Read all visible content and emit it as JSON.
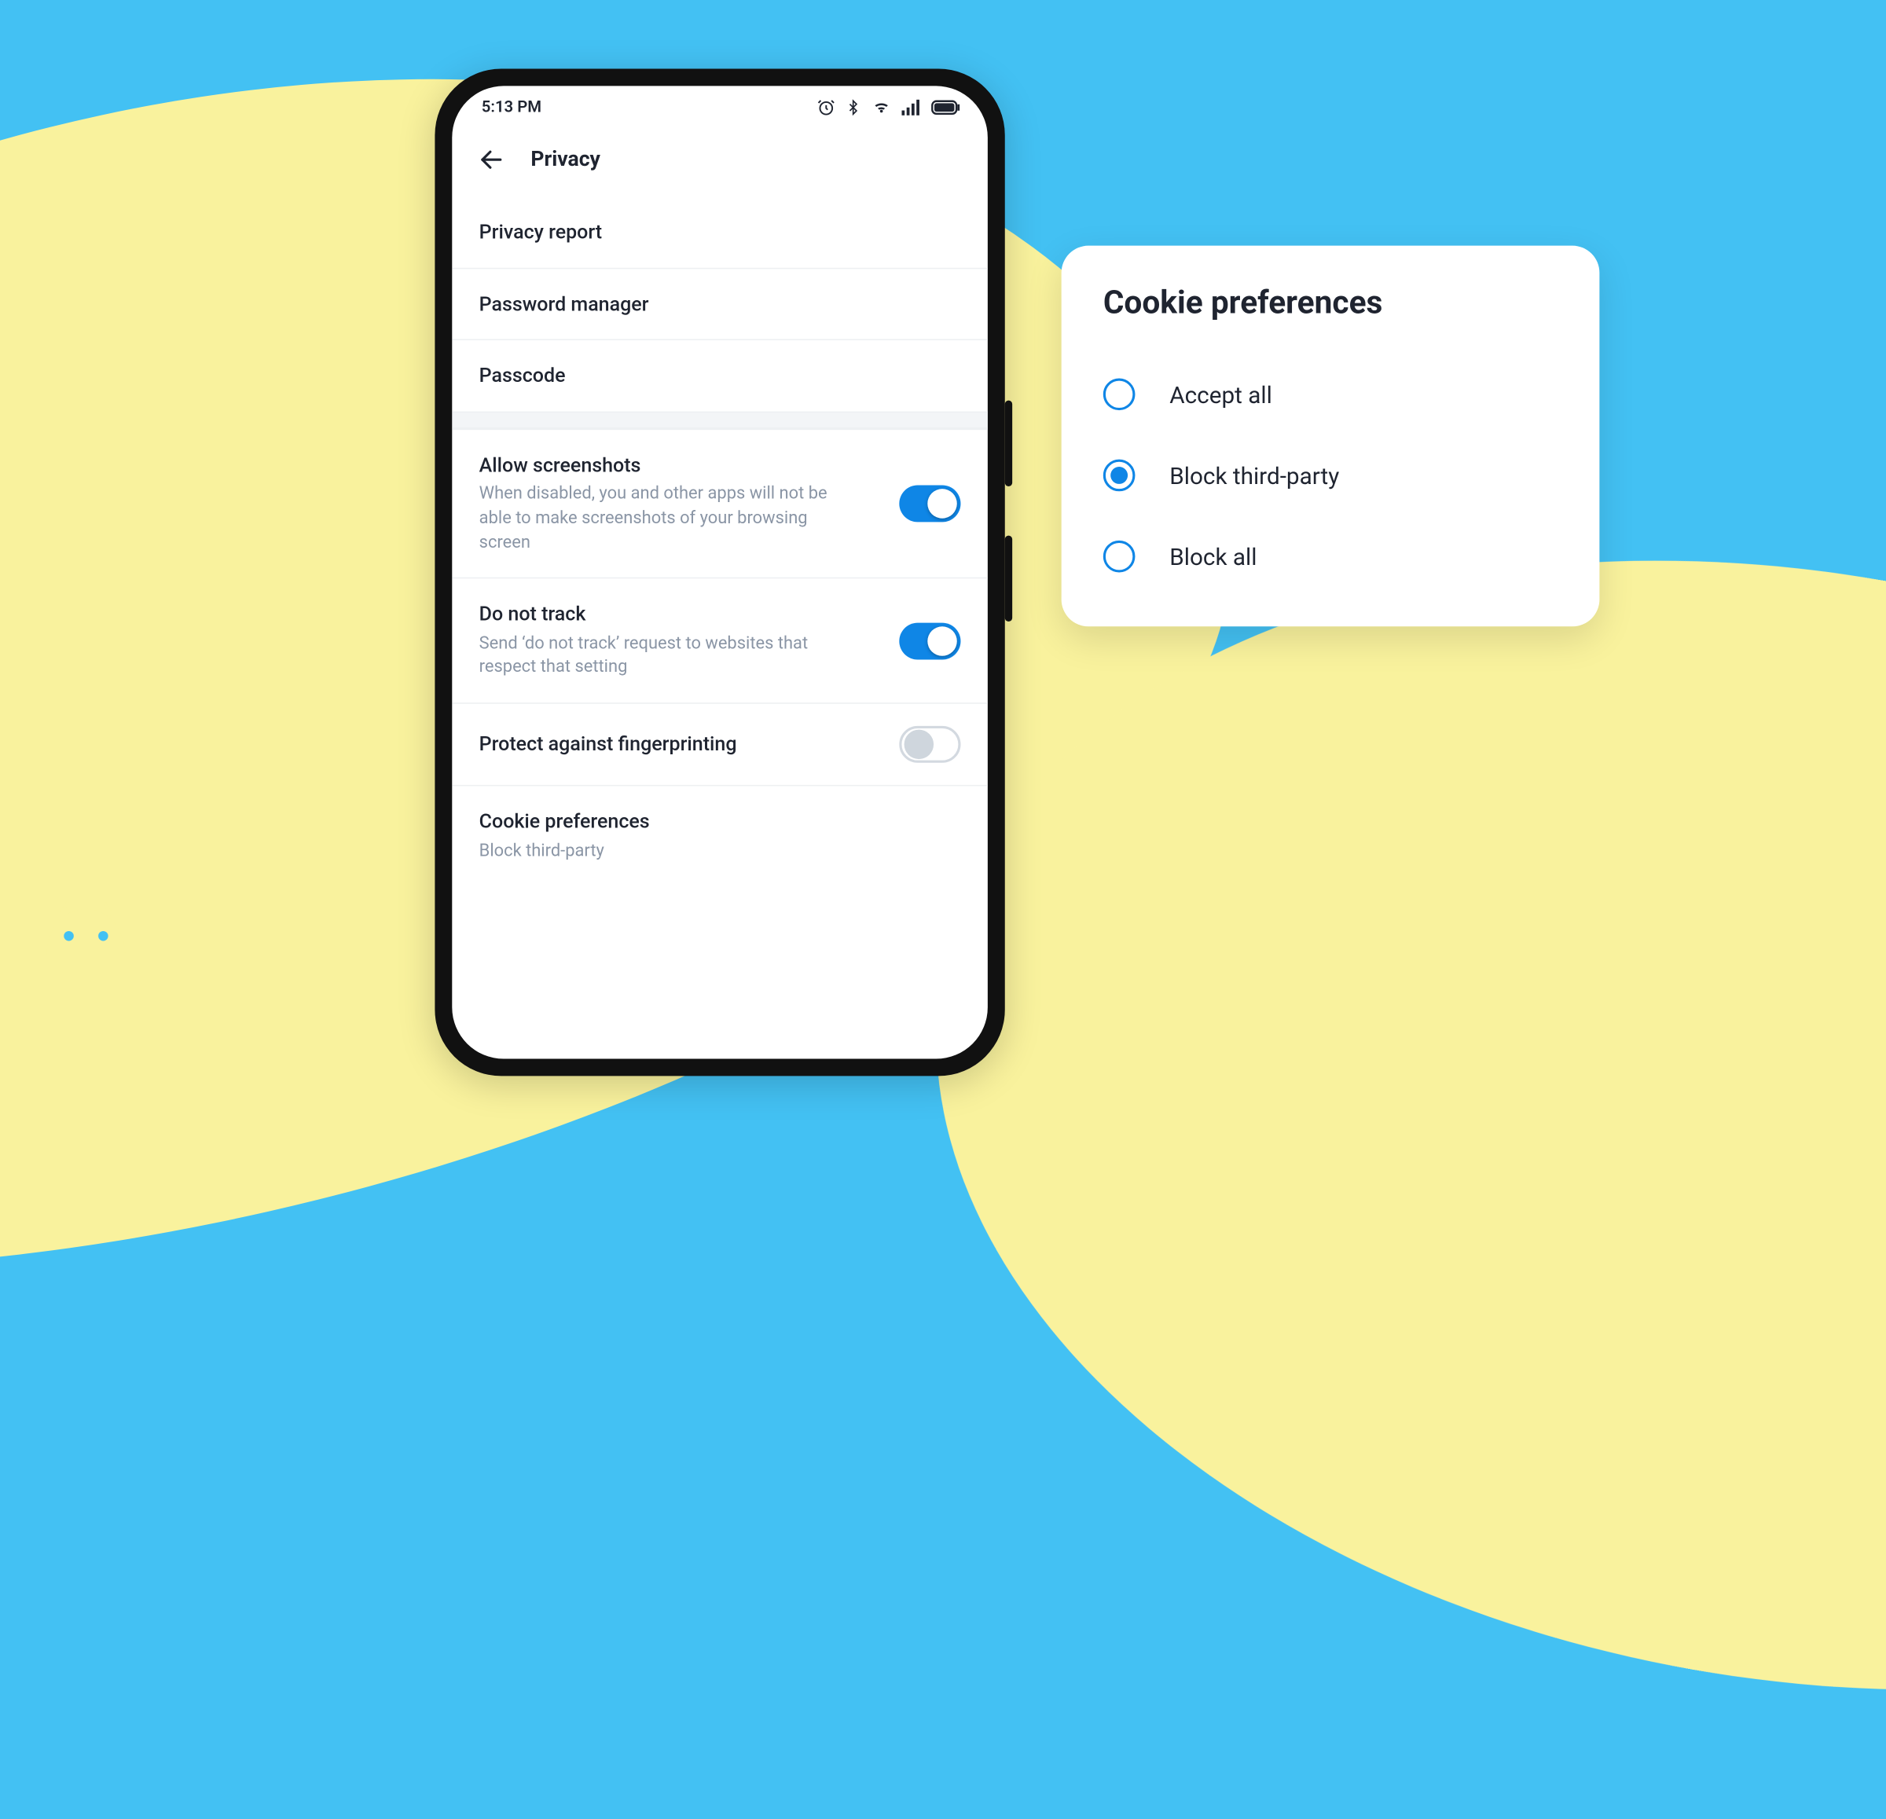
{
  "statusbar": {
    "time": "5:13 PM"
  },
  "appbar": {
    "title": "Privacy"
  },
  "nav_rows": {
    "r0": "Privacy report",
    "r1": "Password manager",
    "r2": "Passcode"
  },
  "toggles": {
    "screenshots": {
      "label": "Allow screenshots",
      "sub": "When disabled, you and other apps will not be able to make screenshots of your browsing screen"
    },
    "dnt": {
      "label": "Do not track",
      "sub": "Send ‘do not track’ request to websites that respect that setting"
    },
    "fingerprint": {
      "label": "Protect against fingerprinting"
    }
  },
  "cookie_row": {
    "label": "Cookie preferences",
    "value": "Block third-party"
  },
  "card": {
    "title": "Cookie preferences",
    "options": {
      "o0": "Accept all",
      "o1": "Block third-party",
      "o2": "Block all"
    }
  }
}
